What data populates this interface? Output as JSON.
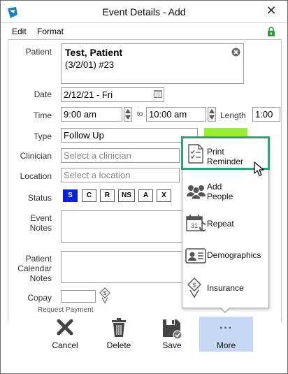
{
  "window": {
    "title": "Event Details - Add",
    "close_glyph": "✕"
  },
  "menu": {
    "items": [
      "Edit",
      "Format"
    ]
  },
  "labels": {
    "patient": "Patient",
    "date": "Date",
    "time": "Time",
    "to": "to",
    "length": "Length",
    "type": "Type",
    "clinician": "Clinician",
    "location": "Location",
    "status": "Status",
    "event_notes": [
      "Event",
      "Notes"
    ],
    "patient_calendar_notes": [
      "Patient",
      "Calendar",
      "Notes"
    ],
    "copay": "Copay",
    "request_payment": "Request Payment"
  },
  "patient": {
    "name": "Test, Patient",
    "details": "(3/2/01) #23"
  },
  "date": {
    "value": "2/12/21 - Fri"
  },
  "time": {
    "start": "9:00 am",
    "end": "10:00 am",
    "length": "1:00"
  },
  "type": {
    "value": "Follow Up",
    "color": "#99ee33"
  },
  "clinician": {
    "placeholder": "Select a clinician"
  },
  "location": {
    "placeholder": "Select a location"
  },
  "status": {
    "buttons": [
      "S",
      "C",
      "R",
      "NS",
      "A",
      "X"
    ],
    "selected": "S",
    "selected_color": "#0a23d9"
  },
  "toolbar": {
    "cancel": "Cancel",
    "delete": "Delete",
    "save": "Save",
    "more": "More",
    "more_glyph": "···"
  },
  "more_menu": {
    "items": [
      {
        "label": [
          "Print",
          "Reminder"
        ],
        "icon": "print-reminder-icon"
      },
      {
        "label": [
          "Add",
          "People"
        ],
        "icon": "add-people-icon"
      },
      {
        "label": [
          "Repeat"
        ],
        "icon": "calendar-repeat-icon",
        "icon_text": "31"
      },
      {
        "label": [
          "Demographics"
        ],
        "icon": "demographics-icon"
      },
      {
        "label": [
          "Insurance"
        ],
        "icon": "insurance-icon"
      }
    ],
    "highlighted_index": 0,
    "highlight_color": "#2aa47a"
  }
}
